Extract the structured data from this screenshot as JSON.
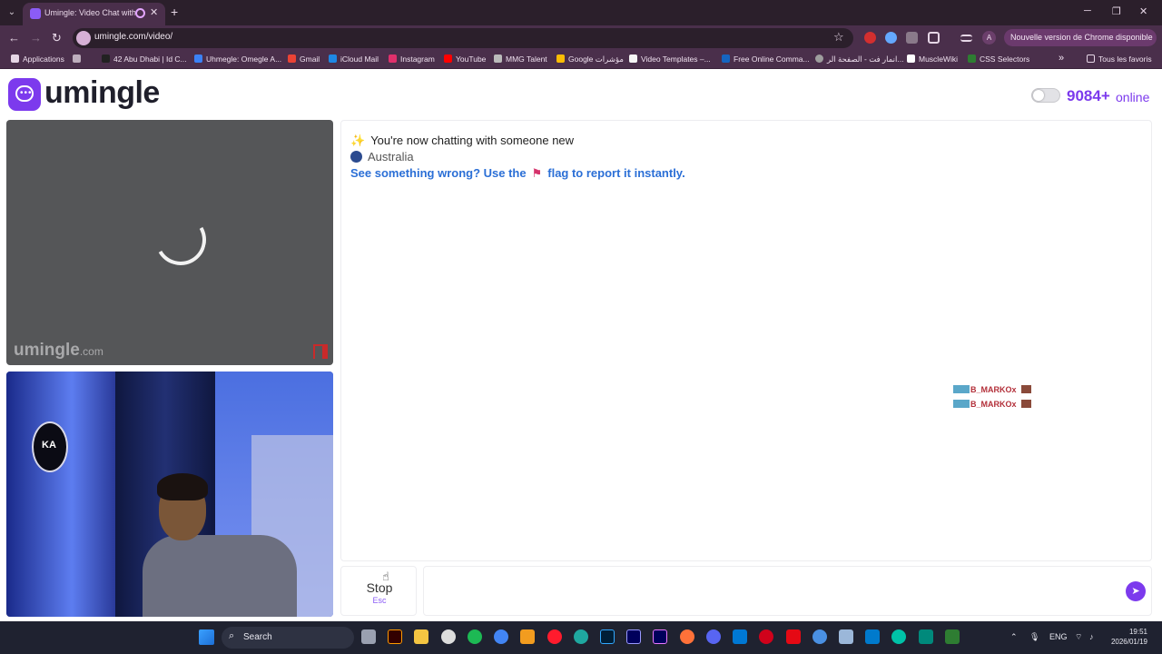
{
  "browser": {
    "tab_title": "Umingle: Video Chat with S",
    "new_tab": "+",
    "url": "umingle.com/video/",
    "update_notice": "Nouvelle version de Chrome disponible",
    "profile_initial": "A",
    "bookmarks": [
      {
        "label": "Applications",
        "color": "#e6d6e6"
      },
      {
        "label": "42 Abu Dhabi | Id C...",
        "color": "#222222"
      },
      {
        "label": "Uhmegle: Omegle A...",
        "color": "#3b82f6"
      },
      {
        "label": "Gmail",
        "color": "#ea4335"
      },
      {
        "label": "iCloud Mail",
        "color": "#1e88e5"
      },
      {
        "label": "Instagram",
        "color": "#e1306c"
      },
      {
        "label": "YouTube",
        "color": "#ff0000"
      },
      {
        "label": "MMG Talent",
        "color": "#bbbbbb"
      },
      {
        "label": "Google مؤشرات",
        "color": "#fbbc05"
      },
      {
        "label": "Video Templates –...",
        "color": "#f5f5f5"
      },
      {
        "label": "Free Online Comma...",
        "color": "#1565c0"
      },
      {
        "label": "انمار فت - الصفحة الر...",
        "color": "#9e9e9e"
      },
      {
        "label": "MuscleWiki",
        "color": "#ffffff"
      },
      {
        "label": "CSS Selectors",
        "color": "#2e7d32"
      }
    ],
    "more_bookmarks": "»",
    "all_bookmarks": "Tous les favoris"
  },
  "header": {
    "logo_text": "umingle",
    "online_count": "9084+",
    "online_label": "online"
  },
  "stranger_video": {
    "watermark": "umingle",
    "watermark_suffix": ".com"
  },
  "self_video": {
    "badge_text": "KA"
  },
  "chat": {
    "status_message": "You're now chatting with someone new",
    "location": "Australia",
    "report_prefix": "See something wrong? Use the",
    "report_suffix": "flag to report it instantly.",
    "overlay_tags": [
      "B_MARKOx",
      "B_MARKOx"
    ]
  },
  "controls": {
    "stop_label": "Stop",
    "stop_key": "Esc",
    "message_placeholder": ""
  },
  "taskbar": {
    "search_label": "Search",
    "language": "ENG",
    "time": "19:51",
    "date": "2026/01/19",
    "apps": [
      "file-explorer",
      "illustrator",
      "chrome-settings",
      "folder",
      "spotify",
      "chrome",
      "fl-studio",
      "opera",
      "edge",
      "photoshop",
      "after-effects",
      "premiere",
      "firefox",
      "discord",
      "outlook",
      "mail",
      "netflix",
      "browser",
      "photos",
      "vscode",
      "app",
      "app2",
      "terminal"
    ]
  },
  "colors": {
    "brand": "#7c3aed",
    "link": "#2b6fd6",
    "chrome_dark": "#2b1f2b",
    "chrome_mid": "#4a2f4b"
  }
}
